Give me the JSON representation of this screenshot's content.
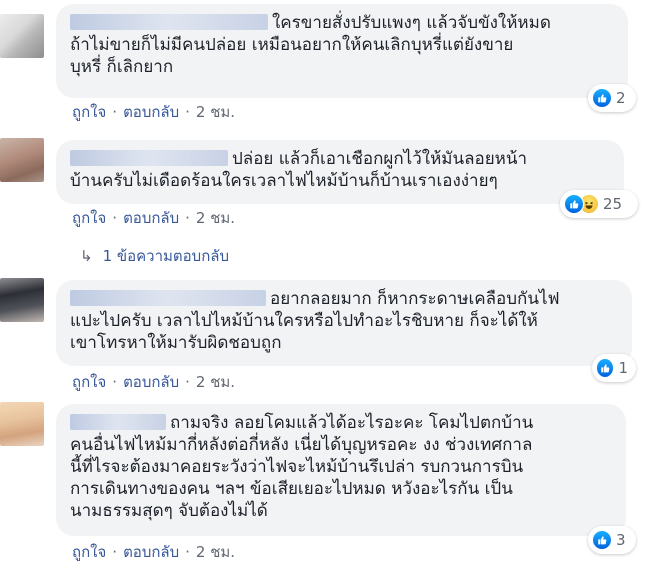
{
  "comments": [
    {
      "text": "ใครขายสั่งปรับแพงๆ แล้วจับขังให้หมด ถ้าไม่ขายก็ไม่มีคนปล่อย เหมือนอยากให้คนเลิกบุหรี่แต่ยังขายบุหรี่ ก็เลิกยาก",
      "line1": "ใครขายสั่งปรับแพงๆ แล้วจับขังให้หมด",
      "line2": "ถ้าไม่ขายก็ไม่มีคนปล่อย เหมือนอยากให้คนเลิกบุหรี่แต่ยังขาย",
      "line3": "บุหรี่ ก็เลิกยาก",
      "like": "ถูกใจ",
      "reply": "ตอบกลับ",
      "time": "2 ชม.",
      "reaction_count": "2",
      "reactions": [
        "like-icon"
      ]
    },
    {
      "line1": "ปล่อย แล้วก็เอาเชือกผูกไว้ให้มันลอยหน้า",
      "line2": "บ้านครับไม่เดือดร้อนใครเวลาไฟไหม้บ้านก็บ้านเราเองง่ายๆ",
      "like": "ถูกใจ",
      "reply": "ตอบกลับ",
      "time": "2 ชม.",
      "reaction_count": "25",
      "reactions": [
        "like-icon",
        "haha-icon"
      ],
      "replies_label": "1 ข้อความตอบกลับ"
    },
    {
      "line1": "อยากลอยมาก ก็หากระดาษเคลือบกันไฟ",
      "line2": "แปะไปครับ เวลาไปไหม้บ้านใครหรือไปทำอะไรชิบหาย ก็จะได้ให้",
      "line3": "เขาโทรหาให้มารับผิดชอบถูก",
      "like": "ถูกใจ",
      "reply": "ตอบกลับ",
      "time": "2 ชม.",
      "reaction_count": "1",
      "reactions": [
        "like-icon"
      ]
    },
    {
      "line1": "ถามจริง ลอยโคมแล้วได้อะไรอะคะ โคมไปตกบ้าน",
      "line2": "คนอื่นไฟไหม้มากี่หลังต่อกี่หลัง เนี่ยได้บุญหรอคะ งง ช่วงเทศกาล",
      "line3": "นี้ที่ไรจะต้องมาคอยระวังว่าไฟจะไหม้บ้านรึเปล่า รบกวนการบิน",
      "line4": "การเดินทางของคน ฯลฯ ข้อเสียเยอะไปหมด หวังอะไรกัน เป็น",
      "line5": "นามธรรมสุดๆ จับต้องไม่ได้",
      "like": "ถูกใจ",
      "reply": "ตอบกลับ",
      "time": "2 ชม.",
      "reaction_count": "3",
      "reactions": [
        "like-icon"
      ]
    }
  ],
  "colors": {
    "bubble": "#f2f3f5",
    "link": "#385898",
    "meta": "#606770",
    "like_blue": "#0062df"
  }
}
